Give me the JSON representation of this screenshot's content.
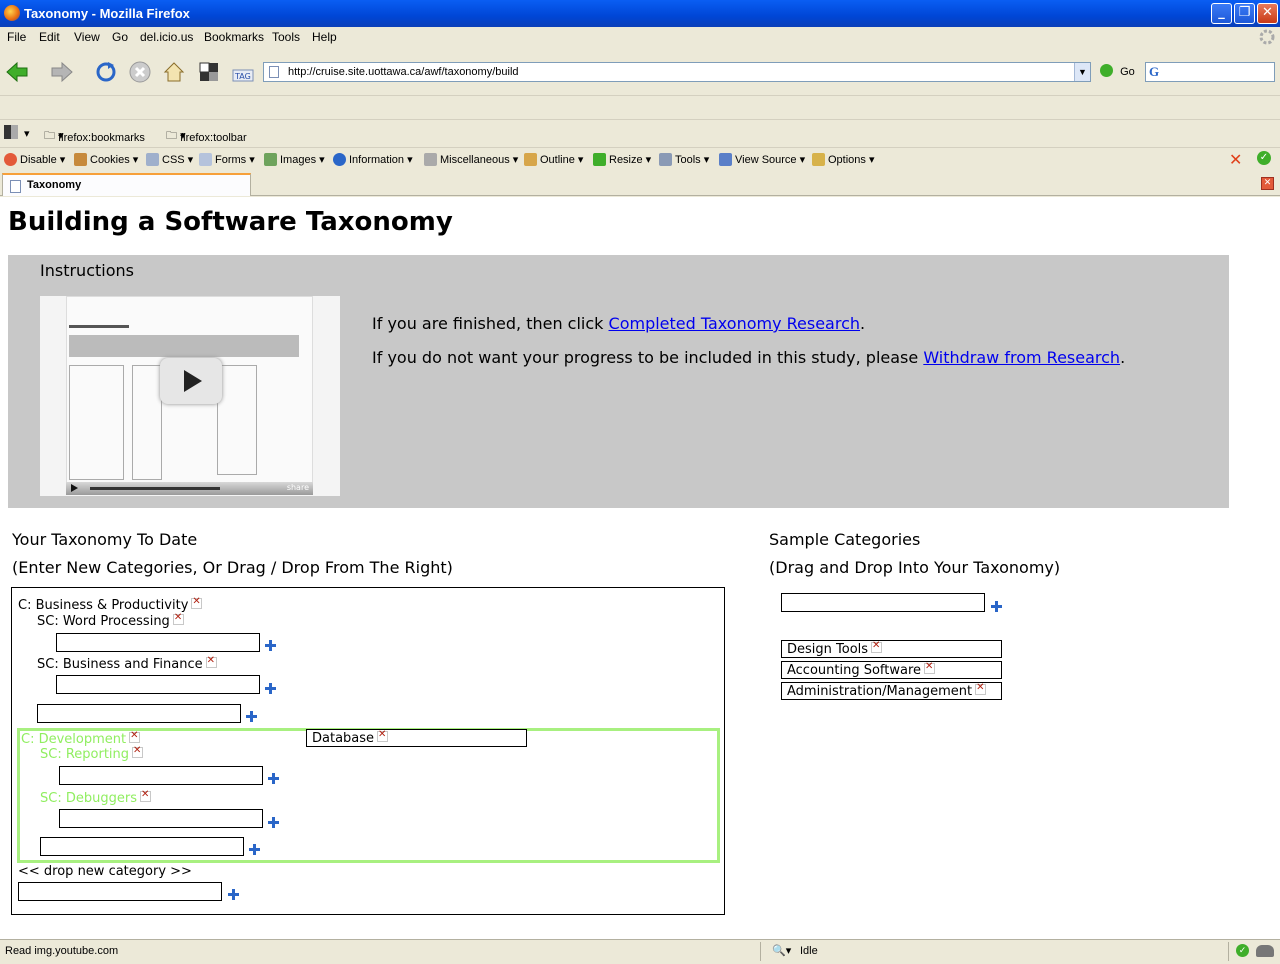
{
  "window": {
    "title": "Taxonomy - Mozilla Firefox"
  },
  "menu": [
    "File",
    "Edit",
    "View",
    "Go",
    "del.icio.us",
    "Bookmarks",
    "Tools",
    "Help"
  ],
  "nav": {
    "url": "http://cruise.site.uottawa.ca/awf/taxonomy/build",
    "go_label": "Go"
  },
  "bookmarks": [
    "firefox:bookmarks",
    "firefox:toolbar"
  ],
  "devtoolbar": [
    "Disable",
    "Cookies",
    "CSS",
    "Forms",
    "Images",
    "Information",
    "Miscellaneous",
    "Outline",
    "Resize",
    "Tools",
    "View Source",
    "Options"
  ],
  "tab": {
    "label": "Taxonomy"
  },
  "page": {
    "title": "Building a Software Taxonomy",
    "instructions_heading": "Instructions",
    "finished_prefix": "If you are finished, then click ",
    "finished_link": "Completed Taxonomy Research",
    "finished_suffix": ".",
    "withdraw_prefix": "If you do not want your progress to be included in this study, please ",
    "withdraw_link": "Withdraw from Research",
    "withdraw_suffix": ".",
    "video_share": "share"
  },
  "taxonomy": {
    "heading1": "Your Taxonomy To Date",
    "heading2": "(Enter New Categories, Or Drag / Drop From The Right)",
    "cat1": "C: Business & Productivity",
    "cat1_sub1": "SC: Word Processing",
    "cat1_sub2": "SC: Business and Finance",
    "cat2": "C: Development",
    "cat2_sub1": "SC: Reporting",
    "cat2_sub2": "SC: Debuggers",
    "dragging": "Database",
    "drop_new": "<< drop new category >>"
  },
  "samples": {
    "heading1": "Sample Categories",
    "heading2": "(Drag and Drop Into Your Taxonomy)",
    "items": [
      "Design Tools",
      "Accounting Software",
      "Administration/Management"
    ]
  },
  "status": {
    "text": "Read img.youtube.com",
    "state": "Idle"
  }
}
